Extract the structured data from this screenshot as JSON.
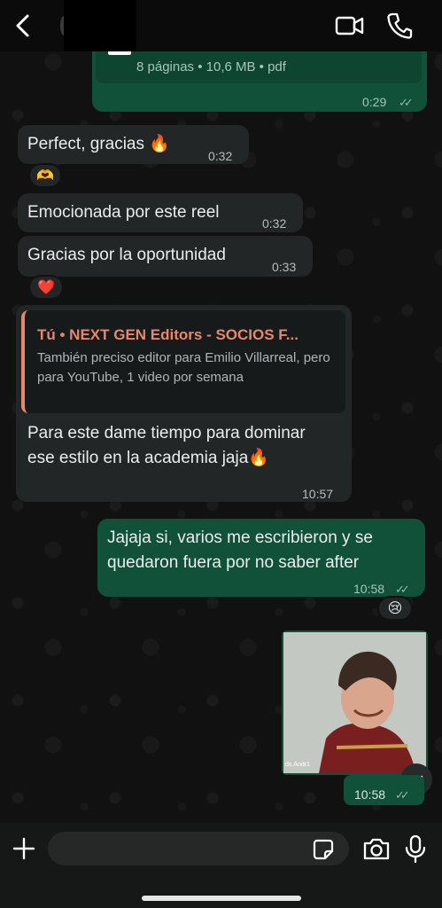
{
  "header": {
    "back_icon": "chevron-left-icon",
    "video_icon": "video-camera-icon",
    "call_icon": "phone-icon"
  },
  "messages": [
    {
      "id": "doc",
      "direction": "out",
      "meta": "8 páginas • 10,6 MB • pdf",
      "time": "0:29",
      "status": "read"
    },
    {
      "id": "m1",
      "direction": "in",
      "text": "Perfect, gracias 🔥",
      "time": "0:32",
      "reaction": "🫶"
    },
    {
      "id": "m2",
      "direction": "in",
      "text": "Emocionada por este reel",
      "time": "0:32"
    },
    {
      "id": "m3",
      "direction": "in",
      "text": "Gracias por la oportunidad",
      "time": "0:33",
      "reaction": "❤️"
    },
    {
      "id": "m4",
      "direction": "in",
      "quote": {
        "title": "Tú • NEXT GEN Editors - SOCIOS F...",
        "text": "También preciso editor para Emilio Villarreal, pero para YouTube, 1 video por semana"
      },
      "text": "Para este dame tiempo para dominar ese estilo en la academia jaja🔥",
      "time": "10:57"
    },
    {
      "id": "m5",
      "direction": "out",
      "text": "Jajaja si, varios me escribieron y se quedaron fuera por no saber after",
      "time": "10:58",
      "status": "read",
      "reaction": "😢"
    },
    {
      "id": "m6",
      "direction": "out",
      "type": "image",
      "caption_watermark": "ds.Andr1",
      "time": "10:58",
      "status": "read"
    }
  ],
  "composer": {
    "placeholder": "",
    "plus_icon": "plus-icon",
    "sticker_icon": "sticker-icon",
    "camera_icon": "camera-icon",
    "mic_icon": "microphone-icon"
  },
  "colors": {
    "incoming": "#232626",
    "outgoing": "#115139",
    "quote_accent": "#e8876e",
    "background": "#111111"
  }
}
